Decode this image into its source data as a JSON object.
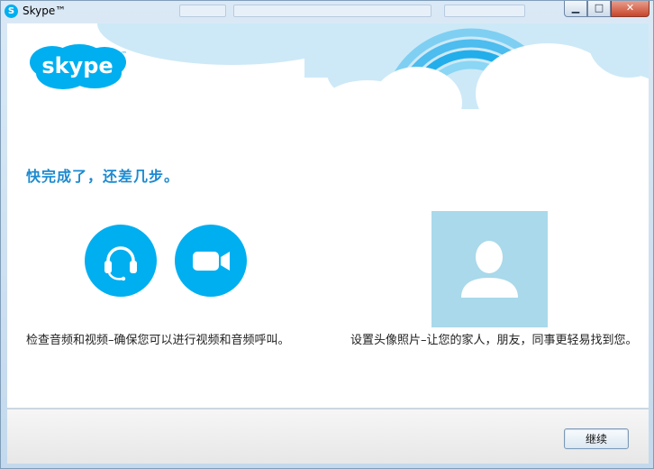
{
  "window": {
    "title": "Skype™",
    "icon_letter": "S",
    "controls": {
      "minimize": "▁",
      "maximize": "□",
      "close": "✕"
    }
  },
  "logo": {
    "text": "skype",
    "tm": "™"
  },
  "main": {
    "heading": "快完成了，还差几步。",
    "audio_video": {
      "headset_icon": "headset-icon",
      "camera_icon": "video-camera-icon",
      "description": "检查音频和视频–确保您可以进行视频和音频呼叫。"
    },
    "profile_photo": {
      "icon": "avatar-placeholder-icon",
      "description": "设置头像照片–让您的家人，朋友，同事更轻易找到您。"
    }
  },
  "footer": {
    "continue_label": "继续"
  },
  "colors": {
    "skype_blue": "#00aff0",
    "heading_blue": "#1c8ad0",
    "avatar_bg": "#a9d9ea",
    "cloud_blue": "#cde9f7"
  }
}
